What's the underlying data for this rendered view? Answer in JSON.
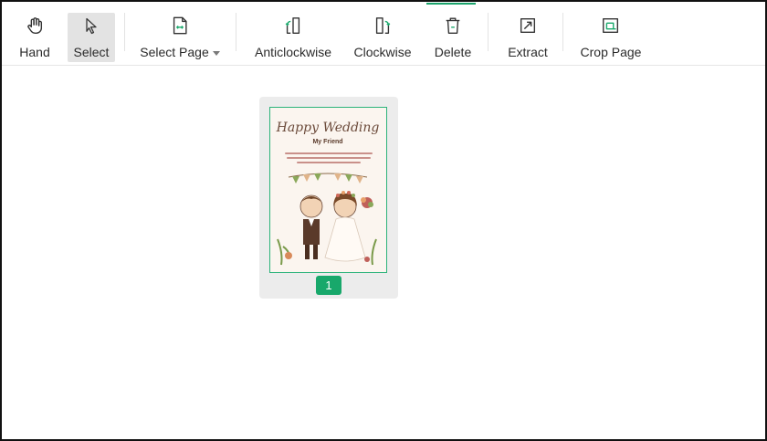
{
  "toolbar": {
    "tools": [
      {
        "label": "Hand",
        "icon": "hand-icon"
      },
      {
        "label": "Select",
        "icon": "cursor-icon",
        "active": true
      },
      {
        "label": "Select Page",
        "icon": "select-page-icon",
        "dropdown": true
      },
      {
        "label": "Anticlockwise",
        "icon": "rotate-anticlockwise-icon"
      },
      {
        "label": "Clockwise",
        "icon": "rotate-clockwise-icon"
      },
      {
        "label": "Delete",
        "icon": "trash-icon"
      },
      {
        "label": "Extract",
        "icon": "extract-icon"
      },
      {
        "label": "Crop Page",
        "icon": "crop-icon"
      }
    ]
  },
  "thumbnail": {
    "page_number": "1",
    "title": "Happy Wedding",
    "subtitle": "My Friend"
  },
  "colors": {
    "accent": "#18a86b",
    "active_tool_bg": "#e3e3e3",
    "thumb_card_bg": "#ececec"
  }
}
